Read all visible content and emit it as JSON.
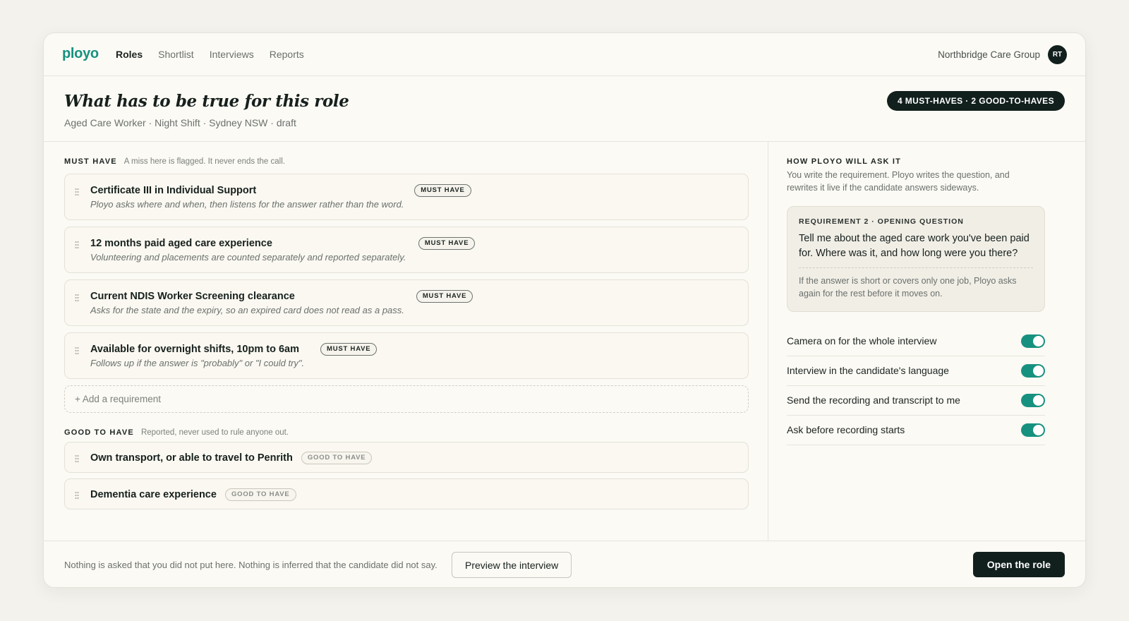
{
  "nav": {
    "logo": "ployo",
    "links": [
      "Roles",
      "Shortlist",
      "Interviews",
      "Reports"
    ],
    "org": "Northbridge Care Group",
    "avatar": "RT"
  },
  "header": {
    "title": "What has to be true for this role",
    "subtitle": "Aged Care Worker · Night Shift · Sydney NSW · draft",
    "summary": "4 MUST-HAVES · 2 GOOD-TO-HAVES"
  },
  "must_have": {
    "heading": "MUST HAVE",
    "description": "A miss here is flagged. It never ends the call.",
    "tag": "MUST HAVE",
    "items": [
      {
        "name": "Certificate III in Individual Support",
        "note": "Ployo asks where and when, then listens for the answer rather than the word."
      },
      {
        "name": "12 months paid aged care experience",
        "note": "Volunteering and placements are counted separately and reported separately."
      },
      {
        "name": "Current NDIS Worker Screening clearance",
        "note": "Asks for the state and the expiry, so an expired card does not read as a pass."
      },
      {
        "name": "Available for overnight shifts, 10pm to 6am",
        "note": "Follows up if the answer is \"probably\" or \"I could try\"."
      }
    ],
    "add_label": "+ Add a requirement"
  },
  "good_to_have": {
    "heading": "GOOD TO HAVE",
    "description": "Reported, never used to rule anyone out.",
    "tag": "GOOD TO HAVE",
    "items": [
      {
        "name": "Own transport, or able to travel to Penrith"
      },
      {
        "name": "Dementia care experience"
      }
    ]
  },
  "ask": {
    "heading": "HOW PLOYO WILL ASK IT",
    "description": "You write the requirement. Ployo writes the question, and rewrites it live if the candidate answers sideways.",
    "question_label": "REQUIREMENT 2 · OPENING QUESTION",
    "question": "Tell me about the aged care work you've been paid for. Where was it, and how long were you there?",
    "followup": "If the answer is short or covers only one job, Ployo asks again for the rest before it moves on."
  },
  "settings": [
    {
      "label": "Camera on for the whole interview",
      "on": true
    },
    {
      "label": "Interview in the candidate's language",
      "on": true
    },
    {
      "label": "Send the recording and transcript to me",
      "on": true
    },
    {
      "label": "Ask before recording starts",
      "on": true
    }
  ],
  "footer": {
    "note": "Nothing is asked that you did not put here. Nothing is inferred that the candidate did not say.",
    "preview_label": "Preview the interview",
    "open_label": "Open the role"
  },
  "colors": {
    "accent": "#17917f",
    "dark": "#12201d",
    "background": "#f4f2ec"
  }
}
